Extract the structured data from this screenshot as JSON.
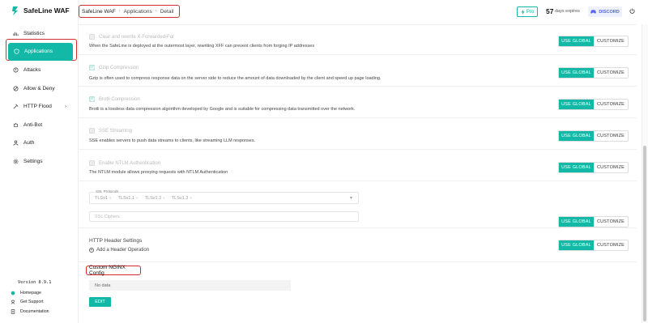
{
  "app": {
    "name": "SafeLine WAF",
    "version": "Version 8.9.1"
  },
  "breadcrumb": {
    "root": "SafeLine WAF",
    "section": "Applications",
    "page": "Detail"
  },
  "header": {
    "pro_label": "Pro",
    "days_count": "57",
    "days_label": "days expires",
    "discord_label": "DISCORD"
  },
  "sidebar": {
    "items": [
      {
        "label": "Statistics",
        "icon": "bar-chart-icon"
      },
      {
        "label": "Applications",
        "icon": "shield-icon",
        "active": true
      },
      {
        "label": "Attacks",
        "icon": "attack-icon"
      },
      {
        "label": "Allow & Deny",
        "icon": "allow-deny-icon"
      },
      {
        "label": "HTTP Flood",
        "icon": "hammer-icon",
        "has_children": true
      },
      {
        "label": "Anti-Bot",
        "icon": "bot-icon"
      },
      {
        "label": "Auth",
        "icon": "person-icon"
      },
      {
        "label": "Settings",
        "icon": "gear-icon"
      }
    ],
    "links": [
      {
        "label": "Homepage",
        "icon": "home-icon"
      },
      {
        "label": "Get Support",
        "icon": "support-icon"
      },
      {
        "label": "Documentation",
        "icon": "doc-icon"
      }
    ]
  },
  "options": [
    {
      "label": "Clear and rewrite X-Forwarded-For",
      "checked": false,
      "description": "When the SafeLine is deployed at the outermost layer, rewriting XFF can prevent clients from forging IP addresses"
    },
    {
      "label": "Gzip Compression",
      "checked": true,
      "description": "Gzip is often used to compress response data on the server side to reduce the amount of data downloaded by the client and speed up page loading."
    },
    {
      "label": "Brotli Compression",
      "checked": true,
      "description": "Brotli is a lossless data compression algorithm developed by Google and is suitable for compressing data transmitted over the network."
    },
    {
      "label": "SSE Streaming",
      "checked": false,
      "description": "SSE enables servers to push data streams to clients, like streaming LLM responses."
    },
    {
      "label": "Enable NTLM Authentication",
      "checked": false,
      "description": "The NTLM module allows proxying requests with NTLM Authentication"
    }
  ],
  "buttons": {
    "use_global": "USE GLOBAL",
    "customize": "CUSTOMIZE",
    "edit": "EDIT"
  },
  "ssl": {
    "protocols_label": "SSL Protocols",
    "protocols": [
      "TLSv1",
      "TLSv1.1",
      "TLSv1.2",
      "TLSv1.3"
    ],
    "ciphers_placeholder": "SSL Ciphers"
  },
  "http_header": {
    "title": "HTTP Header Settings",
    "add_label": "Add a Header Operation"
  },
  "nginx": {
    "title": "Custom NGINX Config",
    "empty_text": "No data"
  },
  "colors": {
    "accent": "#14b8a6",
    "highlight": "#d32f2f",
    "discord": "#5865f2"
  }
}
